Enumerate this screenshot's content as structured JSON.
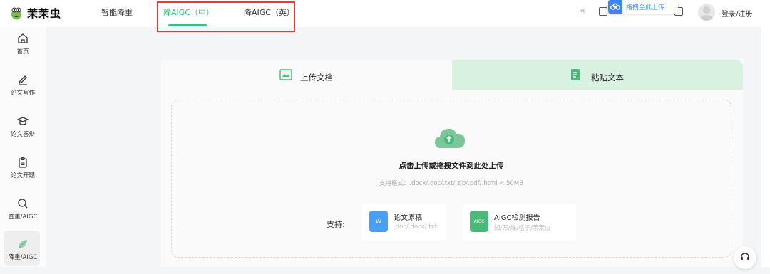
{
  "brand": {
    "name": "茉茉虫"
  },
  "nav": {
    "items": [
      {
        "label": "智能降重"
      },
      {
        "label": "降AIGC（中）"
      },
      {
        "label": "降AIGC（英）"
      }
    ],
    "collapse_symbol": "«"
  },
  "baidu_popup": {
    "label": "拖拽至此上传"
  },
  "user": {
    "login_label": "登录/注册"
  },
  "sidebar": {
    "items": [
      {
        "label": "首页",
        "icon": "home-icon"
      },
      {
        "label": "论文写作",
        "icon": "pen-icon"
      },
      {
        "label": "论文答辩",
        "icon": "graduation-cap-icon"
      },
      {
        "label": "论文开题",
        "icon": "clipboard-icon"
      },
      {
        "label": "查重/AIGC",
        "icon": "search-icon"
      },
      {
        "label": "降重/AIGC",
        "icon": "leaf-icon"
      }
    ]
  },
  "tabs": {
    "upload": "上传文档",
    "paste": "粘贴文本"
  },
  "upload": {
    "title": "点击上传或拖拽文件到此处上传",
    "hint": "支持格式：.docx/.doc/.txt/.zip/.pdf/.html < 50MB",
    "support_label": "支持:"
  },
  "file_types": [
    {
      "title": "论文原稿",
      "sub": ".doc/.docx/.txt",
      "icon_text": "W",
      "icon": "word-doc-icon"
    },
    {
      "title": "AIGC检测报告",
      "sub": "知/万/维/格子/茉茉虫",
      "icon_text": "AIGC",
      "icon": "aigc-report-icon"
    }
  ],
  "colors": {
    "accent": "#35c07b",
    "highlight": "#e33b3b",
    "tab_inactive": "#d9f1e1"
  }
}
